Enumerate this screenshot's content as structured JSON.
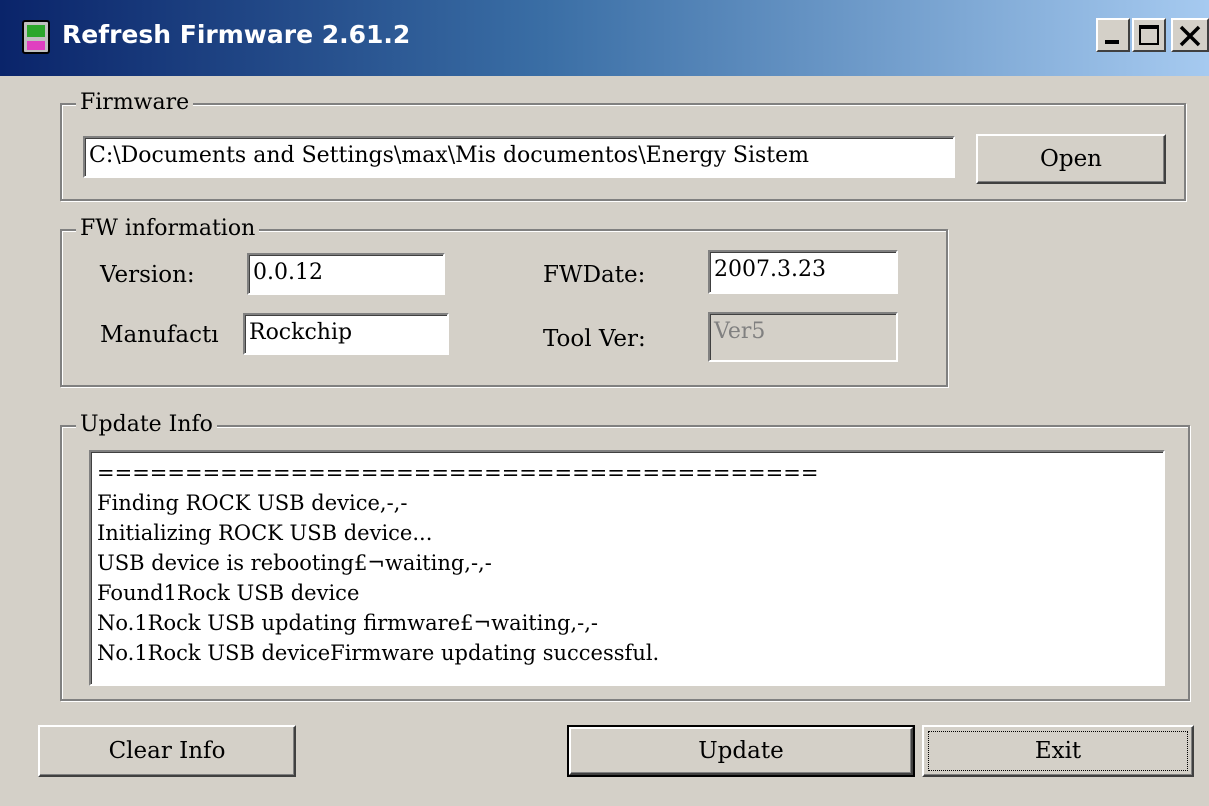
{
  "window": {
    "title": "Refresh Firmware 2.61.2",
    "colors": {
      "titlebar_start": "#0a246a",
      "titlebar_end": "#a6caf0",
      "face": "#d4d0c8"
    }
  },
  "firmware": {
    "group_label": "Firmware",
    "path_value": "C:\\Documents and Settings\\max\\Mis documentos\\Energy Sistem",
    "open_label": "Open"
  },
  "fw_info": {
    "group_label": "FW information",
    "version_label": "Version:",
    "version_value": "0.0.12",
    "manufacturer_label": "Manufactı",
    "manufacturer_value": "Rockchip",
    "fwdate_label": "FWDate:",
    "fwdate_value": "2007.3.23",
    "toolver_label": "Tool Ver:",
    "toolver_value": "Ver5"
  },
  "update_info": {
    "group_label": "Update Info",
    "lines": [
      "=========================================",
      "Finding ROCK USB device,-,-",
      "Initializing ROCK USB device...",
      "USB device is rebooting£¬waiting,-,-",
      "Found1Rock USB device",
      "No.1Rock USB updating firmware£¬waiting,-,-",
      "No.1Rock USB deviceFirmware updating successful."
    ]
  },
  "buttons": {
    "clear_info": "Clear Info",
    "update": "Update",
    "exit": "Exit"
  },
  "icons": {
    "app": "handheld-player-icon",
    "minimize": "minimize-icon",
    "maximize": "maximize-icon",
    "close": "close-icon"
  }
}
